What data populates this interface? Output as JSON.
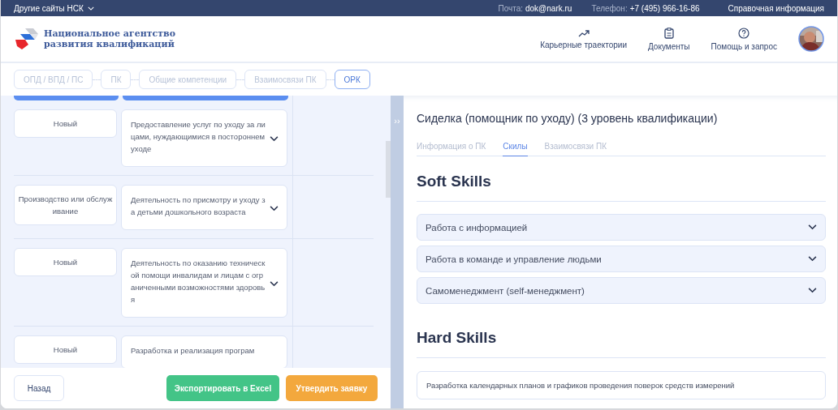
{
  "top_bar": {
    "sites_menu": "Другие сайты НСК",
    "mail_label": "Почта:",
    "mail": "dok@nark.ru",
    "phone_label": "Телефон:",
    "phone": "+7 (495) 966-16-86",
    "info_link": "Справочная информация"
  },
  "header": {
    "logo_line1": "Национальное агентство",
    "logo_line2": "развития квалификаций",
    "nav": [
      {
        "kind": "trend",
        "label": "Карьерные траектории"
      },
      {
        "kind": "clipboard",
        "label": "Документы"
      },
      {
        "kind": "help",
        "label": "Помощь и запрос"
      }
    ]
  },
  "steps": [
    {
      "label": "ОПД / ВПД / ПС",
      "selected": false
    },
    {
      "label": "ПК",
      "selected": false
    },
    {
      "label": "Общие компетенции",
      "selected": false
    },
    {
      "label": "Взаимосвязи ПК",
      "selected": false
    },
    {
      "label": "ОРК",
      "selected": true
    }
  ],
  "rows": [
    {
      "status": "Новый",
      "activity": "Предоставление услуг по уходу за лицами, нуждающимися в постороннем уходе"
    },
    {
      "status": "Производство или обслуживание",
      "activity": "Деятельность по присмотру и уходу за детьми дошкольного возраста"
    },
    {
      "status": "Новый",
      "activity": "Деятельность по оказанию технической помощи инвалидам и лицам с ограниченными возможностями здоровья"
    },
    {
      "status": "Новый",
      "activity": "Разработка и реализация програм"
    }
  ],
  "footer": {
    "back": "Назад",
    "export": "Экспортировать в Excel",
    "approve": "Утвердить заявку"
  },
  "panel_toggle": "››",
  "detail": {
    "title": "Сиделка (помощник по уходу) (3 уровень квалификации)",
    "tabs": [
      {
        "label": "Информация о ПК",
        "selected": false
      },
      {
        "label": "Скилы",
        "selected": true
      },
      {
        "label": "Взаимосвязи ПК",
        "selected": false
      }
    ],
    "soft_title": "Soft Skills",
    "soft_skills": [
      "Работа с информацией",
      "Работа в команде и управление людьми",
      "Самоменеджмент (self-менеджмент)"
    ],
    "hard_title": "Hard Skills",
    "hard_skills": [
      "Разработка календарных планов и графиков проведения поверок средств измерений"
    ]
  }
}
